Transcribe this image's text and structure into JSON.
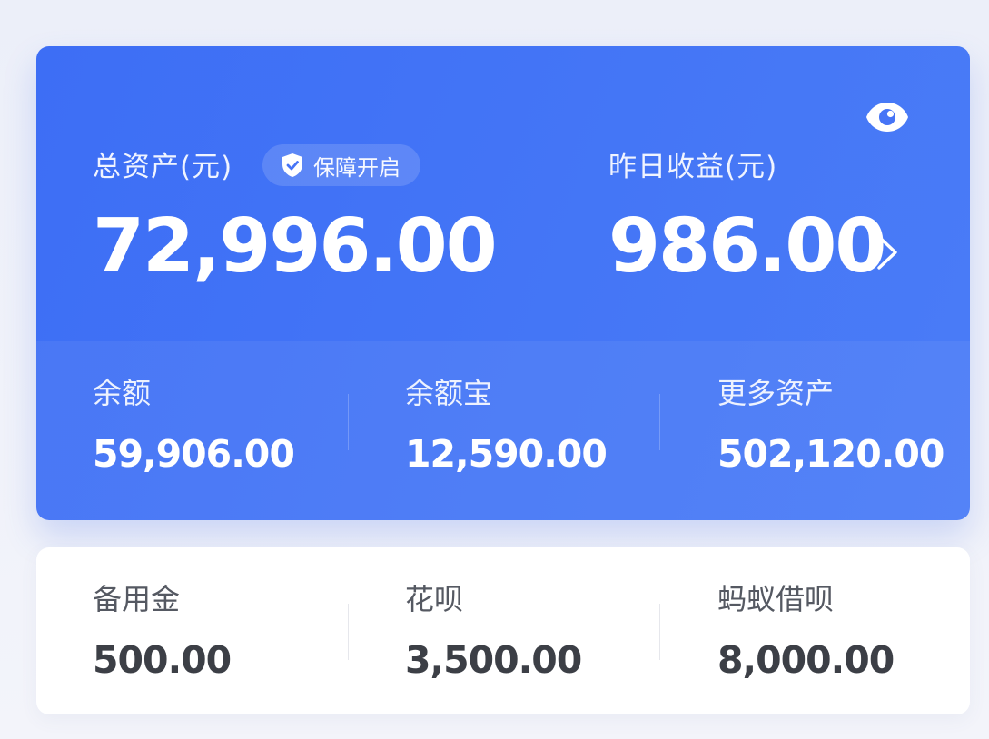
{
  "summary": {
    "total_label": "总资产(元)",
    "protect_badge": "保障开启",
    "total_value": "72,996.00",
    "yesterday_label": "昨日收益(元)",
    "yesterday_value": "986.00",
    "eye_icon": "eye-icon",
    "shield_icon": "shield-check-icon",
    "chevron_icon": "chevron-right-icon"
  },
  "accounts": [
    {
      "label": "余额",
      "value": "59,906.00"
    },
    {
      "label": "余额宝",
      "value": "12,590.00"
    },
    {
      "label": "更多资产",
      "value": "502,120.00"
    }
  ],
  "credit": [
    {
      "label": "备用金",
      "value": "500.00"
    },
    {
      "label": "花呗",
      "value": "3,500.00"
    },
    {
      "label": "蚂蚁借呗",
      "value": "8,000.00"
    }
  ],
  "colors": {
    "card_blue": "#3d6ef5",
    "text_white": "#ffffff",
    "text_dark": "#3c3f46"
  }
}
